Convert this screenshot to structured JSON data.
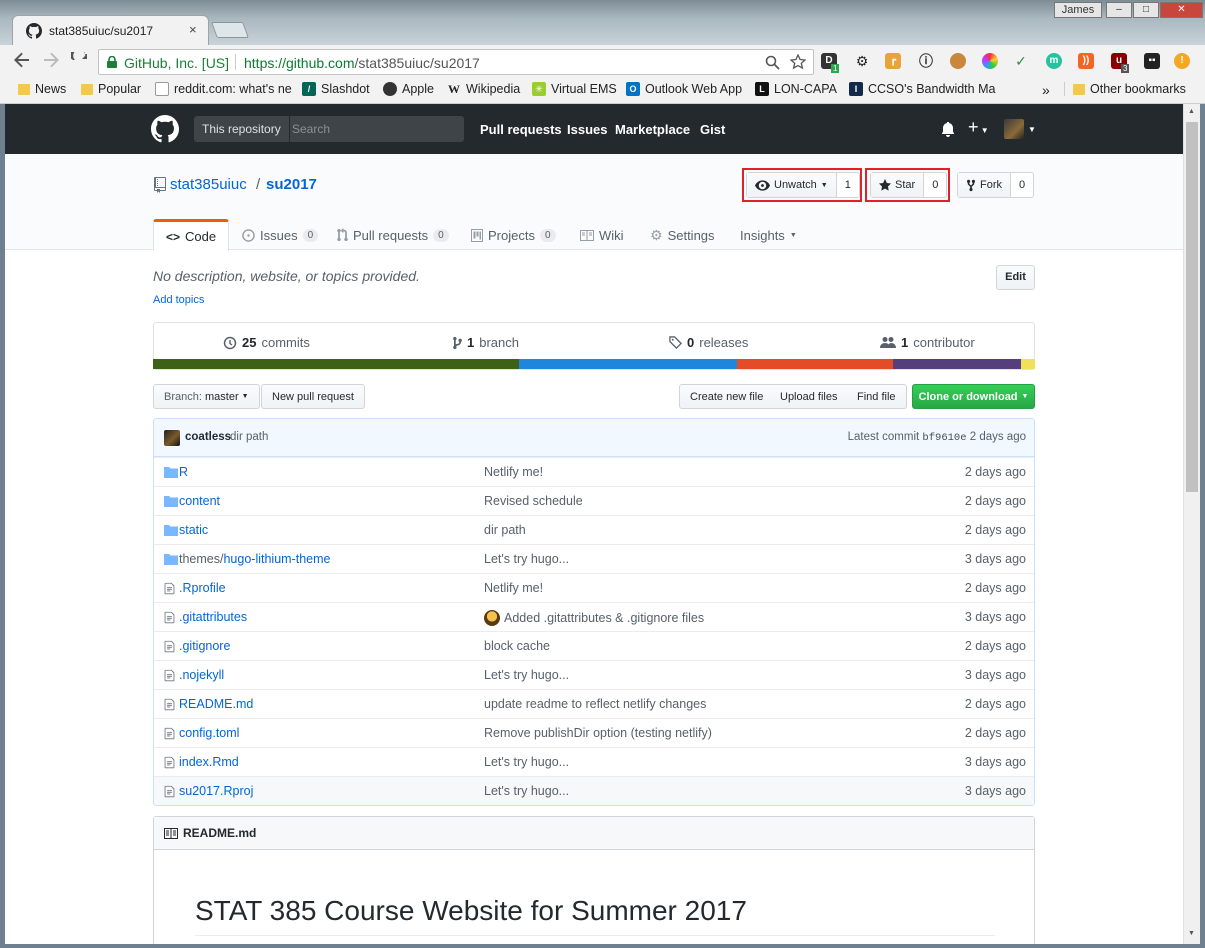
{
  "browser": {
    "tab_title": "stat385uiuc/su2017",
    "tab_close": "×",
    "user": "James",
    "win_min": "–",
    "win_max": "□",
    "win_close": "✕",
    "secure_label": "GitHub, Inc. [US]",
    "url_host": "https://github.com",
    "url_path": "/stat385uiuc/su2017",
    "ext_badge_1": "1",
    "ext_badge_2": "3",
    "bookmarks": [
      {
        "label": "News",
        "icon": "folder-icon"
      },
      {
        "label": "Popular",
        "icon": "folder-icon"
      },
      {
        "label": "reddit.com: what's ne",
        "icon": "page-icon"
      },
      {
        "label": "Slashdot",
        "icon": "slashdot-icon"
      },
      {
        "label": "Apple",
        "icon": "apple-icon"
      },
      {
        "label": "Wikipedia",
        "icon": "wikipedia-icon"
      },
      {
        "label": "Virtual EMS",
        "icon": "ems-icon"
      },
      {
        "label": "Outlook Web App",
        "icon": "outlook-icon"
      },
      {
        "label": "LON-CAPA",
        "icon": "loncapa-icon"
      },
      {
        "label": "CCSO's Bandwidth Ma",
        "icon": "illinois-icon"
      }
    ],
    "bookmarks_more": "»",
    "other_bookmarks": "Other bookmarks"
  },
  "github": {
    "scope_label": "This repository",
    "search_placeholder": "Search",
    "nav": [
      "Pull requests",
      "Issues",
      "Marketplace",
      "Gist"
    ],
    "plus_symbol": "+"
  },
  "repo": {
    "owner": "stat385uiuc",
    "separator": "/",
    "name": "su2017",
    "unwatch_label": "Unwatch",
    "watch_count": "1",
    "star_label": "Star",
    "star_count": "0",
    "fork_label": "Fork",
    "fork_count": "0",
    "tabs": [
      {
        "label": "Code",
        "count": ""
      },
      {
        "label": "Issues",
        "count": "0"
      },
      {
        "label": "Pull requests",
        "count": "0"
      },
      {
        "label": "Projects",
        "count": "0"
      },
      {
        "label": "Wiki",
        "count": ""
      },
      {
        "label": "Settings",
        "count": ""
      },
      {
        "label": "Insights",
        "count": ""
      }
    ],
    "description": "No description, website, or topics provided.",
    "add_topics": "Add topics",
    "edit_label": "Edit",
    "stats": {
      "commits_num": "25",
      "commits_label": "commits",
      "branch_num": "1",
      "branch_label": "branch",
      "releases_num": "0",
      "releases_label": "releases",
      "contributor_num": "1",
      "contributor_label": "contributor"
    },
    "language_bar": [
      {
        "color": "#3d6117",
        "share": 0.415
      },
      {
        "color": "#1f86de",
        "share": 0.247
      },
      {
        "color": "#e34c26",
        "share": 0.177
      },
      {
        "color": "#563d7c",
        "share": 0.145
      },
      {
        "color": "#f1e05a",
        "share": 0.016
      }
    ]
  },
  "filenav": {
    "branch_prefix": "Branch:",
    "branch_name": "master",
    "new_pr": "New pull request",
    "create_file": "Create new file",
    "upload_files": "Upload files",
    "find_file": "Find file",
    "clone": "Clone or download"
  },
  "commit": {
    "author": "coatless",
    "message": "dir path",
    "latest_prefix": "Latest commit",
    "sha": "bf9610e",
    "age": "2 days ago"
  },
  "files": [
    {
      "type": "dir",
      "name": "R",
      "msg": "Netlify me!",
      "age": "2 days ago"
    },
    {
      "type": "dir",
      "name": "content",
      "msg": "Revised schedule",
      "age": "2 days ago"
    },
    {
      "type": "dir",
      "name": "static",
      "msg": "dir path",
      "age": "2 days ago"
    },
    {
      "type": "dir",
      "name_prefix": "themes/",
      "name": "hugo-lithium-theme",
      "msg": "Let's try hugo...",
      "age": "3 days ago"
    },
    {
      "type": "file",
      "name": ".Rprofile",
      "msg": "Netlify me!",
      "age": "2 days ago"
    },
    {
      "type": "file",
      "name": ".gitattributes",
      "msg": "Added .gitattributes & .gitignore files",
      "age": "3 days ago",
      "emoji": true
    },
    {
      "type": "file",
      "name": ".gitignore",
      "msg": "block cache",
      "age": "2 days ago"
    },
    {
      "type": "file",
      "name": ".nojekyll",
      "msg": "Let's try hugo...",
      "age": "3 days ago"
    },
    {
      "type": "file",
      "name": "README.md",
      "msg": "update readme to reflect netlify changes",
      "age": "2 days ago"
    },
    {
      "type": "file",
      "name": "config.toml",
      "msg": "Remove publishDir option (testing netlify)",
      "age": "2 days ago"
    },
    {
      "type": "file",
      "name": "index.Rmd",
      "msg": "Let's try hugo...",
      "age": "3 days ago"
    },
    {
      "type": "file",
      "name": "su2017.Rproj",
      "msg": "Let's try hugo...",
      "age": "3 days ago"
    }
  ],
  "readme": {
    "file_label": "README.md",
    "heading": "STAT 385 Course Website for Summer 2017"
  }
}
